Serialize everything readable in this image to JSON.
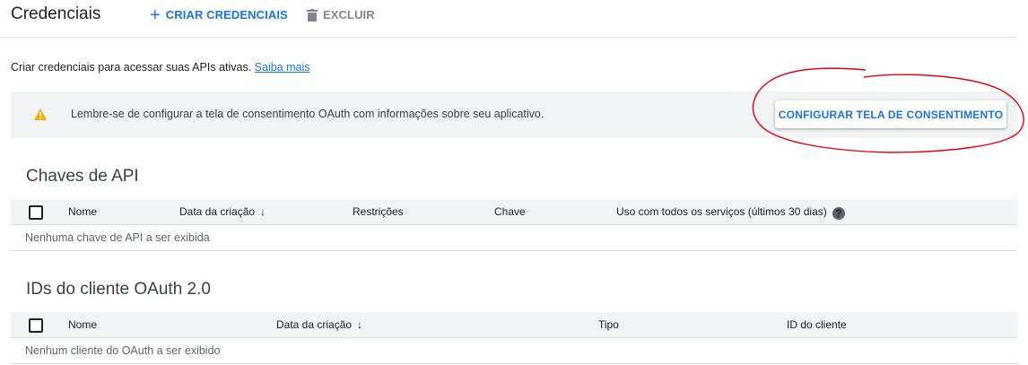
{
  "header": {
    "title": "Credenciais",
    "create_label": "CRIAR CREDENCIAIS",
    "delete_label": "EXCLUIR"
  },
  "intro": {
    "text": "Criar credenciais para acessar suas APIs ativas.",
    "link": "Saiba mais"
  },
  "banner": {
    "message": "Lembre-se de configurar a tela de consentimento OAuth com informações sobre seu aplicativo.",
    "button_label": "CONFIGURAR TELA DE CONSENTIMENTO"
  },
  "api_keys": {
    "title": "Chaves de API",
    "columns": [
      "Nome",
      "Data da criação",
      "Restrições",
      "Chave",
      "Uso com todos os serviços (últimos 30 dias)"
    ],
    "empty": "Nenhuma chave de API a ser exibida"
  },
  "oauth": {
    "title": "IDs do cliente OAuth 2.0",
    "columns": [
      "Nome",
      "Data da criação",
      "Tipo",
      "ID do cliente"
    ],
    "empty": "Nenhum cliente do OAuth a ser exibido"
  },
  "colors": {
    "accent": "#1a73e8",
    "warning": "#f9ab00",
    "annotation": "#e8000b"
  },
  "icons": {
    "create": "plus-icon",
    "delete": "trash-icon",
    "warning": "warning-icon",
    "sort": "arrow-down-icon",
    "help": "help-icon"
  }
}
